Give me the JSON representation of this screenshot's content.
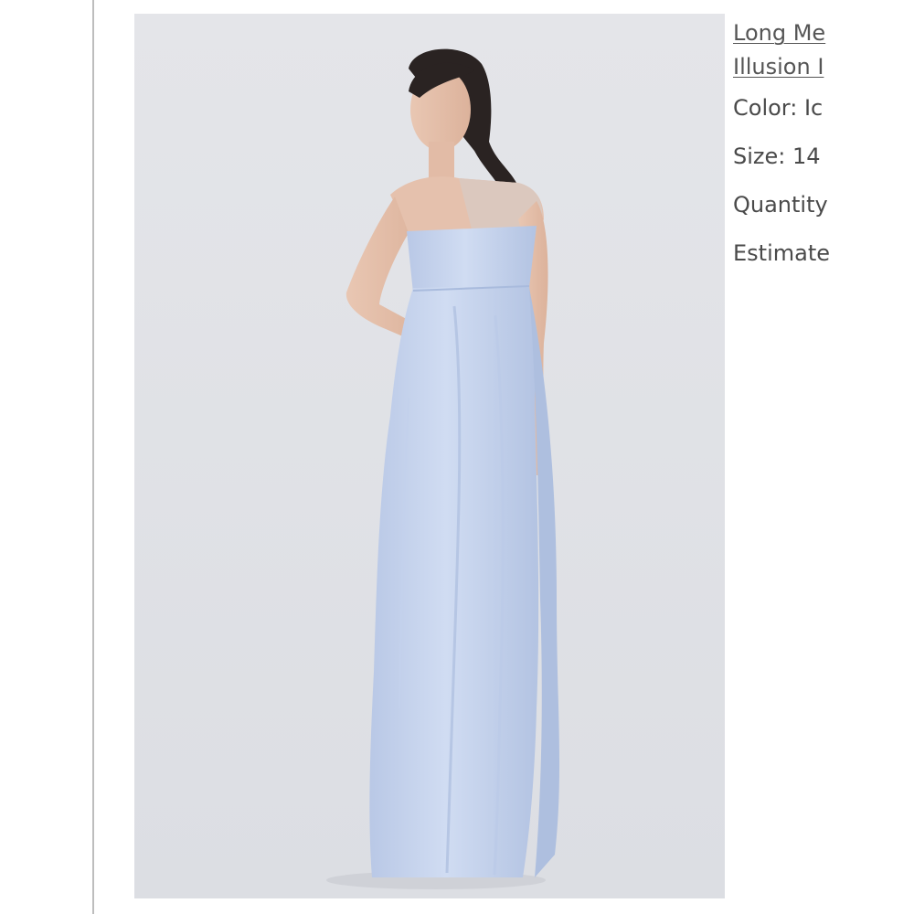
{
  "product": {
    "title_line1": "Long Me",
    "title_line2": "Illusion I",
    "color_text": "Color: Ic",
    "size_text": "Size: 14",
    "quantity_text": "Quantity",
    "estimate_text": "Estimate"
  },
  "colors": {
    "background": "#ffffff",
    "photo_backdrop": "#e2e4e8",
    "dress": "#c9d6ee",
    "text": "#4a4a4a",
    "border": "#bdbdbd"
  }
}
